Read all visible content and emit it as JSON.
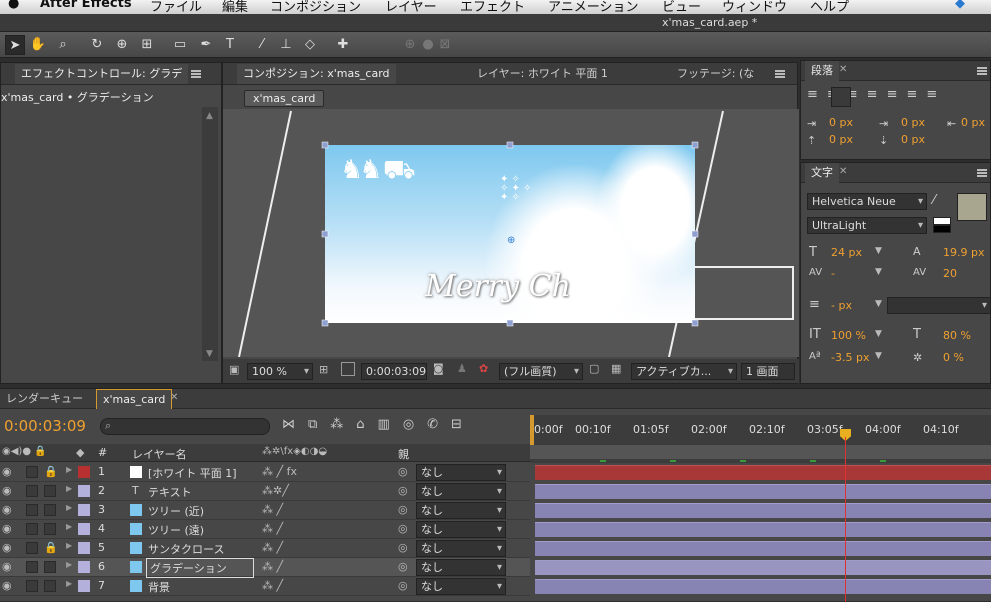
{
  "menubar": {
    "apple": "",
    "app": "After Effects",
    "items": [
      "ファイル",
      "編集",
      "コンポジション",
      "レイヤー",
      "エフェクト",
      "アニメーション",
      "ビュー",
      "ウィンドウ",
      "ヘルプ"
    ]
  },
  "window_title": "x'mas_card.aep *",
  "effect_panel": {
    "tab": "エフェクトコントロール: グラデ",
    "subtitle": "x'mas_card • グラデーション"
  },
  "comp_panel": {
    "tab1": "コンポジション: x'mas_card",
    "tab2": "レイヤー: ホワイト 平面 1",
    "tab3": "フッテージ: (な",
    "comp_button": "x'mas_card",
    "canvas_text": "Merry Ch",
    "zoom": "100 %",
    "timecode": "0:00:03:09",
    "quality": "(フル画質)",
    "view": "アクティブカ...",
    "views": "1 画面"
  },
  "paragraph_panel": {
    "tab": "段落",
    "indent_left": "0 px",
    "indent_first": "0 px",
    "indent_right": "0 px",
    "space_before": "0 px",
    "space_after": "0 px"
  },
  "character_panel": {
    "tab": "文字",
    "font": "Helvetica Neue",
    "style": "UltraLight",
    "size": "24 px",
    "leading": "19.9 px",
    "kerning": "-",
    "tracking": "20",
    "stroke": "- px",
    "vscale": "100 %",
    "hscale": "80 %",
    "baseline": "-3.5 px",
    "tsume": "0 %"
  },
  "timeline": {
    "tab_render": "レンダーキュー",
    "tab_comp": "x'mas_card",
    "timecode": "0:00:03:09",
    "col_num": "#",
    "col_name": "レイヤー名",
    "col_parent": "親",
    "ruler": [
      "0:00f",
      "00:10f",
      "01:05f",
      "02:00f",
      "02:10f",
      "03:05f",
      "04:00f",
      "04:10f"
    ],
    "layers": [
      {
        "num": "1",
        "name": "[ホワイト 平面 1]",
        "color": "#b83030",
        "parent": "なし"
      },
      {
        "num": "2",
        "name": "テキスト",
        "color": "#b4b0dc",
        "parent": "なし"
      },
      {
        "num": "3",
        "name": "ツリー (近)",
        "color": "#b4b0dc",
        "parent": "なし"
      },
      {
        "num": "4",
        "name": "ツリー (遠)",
        "color": "#b4b0dc",
        "parent": "なし"
      },
      {
        "num": "5",
        "name": "サンタクロース",
        "color": "#b4b0dc",
        "parent": "なし"
      },
      {
        "num": "6",
        "name": "グラデーション",
        "color": "#b4b0dc",
        "parent": "なし"
      },
      {
        "num": "7",
        "name": "背景",
        "color": "#b4b0dc",
        "parent": "なし"
      }
    ]
  },
  "colors": {
    "accent": "#f0a030",
    "layer_bar": "#8784b4",
    "solid_bar": "#a83838",
    "playhead": "#e03030"
  }
}
